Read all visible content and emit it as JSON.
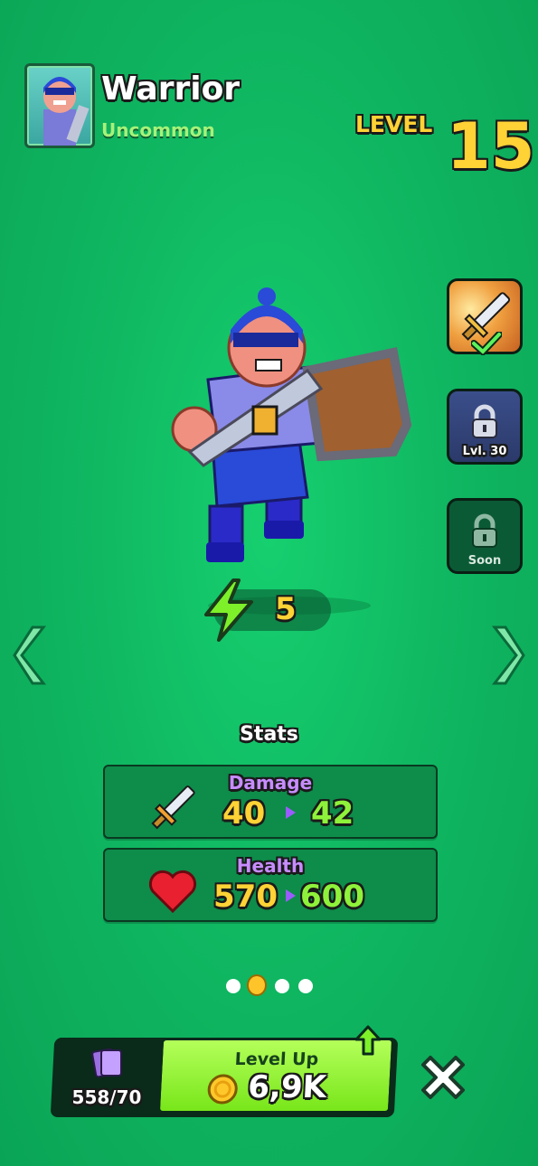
{
  "hero": {
    "name": "Warrior",
    "rarity": "Uncommon",
    "level_label": "LEVEL",
    "level": "15"
  },
  "skills": [
    {
      "name": "sword-skill",
      "state": "equipped"
    },
    {
      "name": "locked-skill",
      "caption": "Lvl. 30"
    },
    {
      "name": "coming-soon-skill",
      "caption": "Soon"
    }
  ],
  "energy": {
    "value": "5"
  },
  "stats": {
    "title": "Stats",
    "damage": {
      "label": "Damage",
      "current": "40",
      "next": "42"
    },
    "health": {
      "label": "Health",
      "current": "570",
      "next": "600"
    }
  },
  "pagination": {
    "count": 4,
    "active_index": 1
  },
  "footer": {
    "cards_count": "558/70",
    "levelup_label": "Level Up",
    "levelup_cost": "6,9K"
  },
  "colors": {
    "accent_yellow": "#ffd235",
    "stat_new_green": "#8ef23a",
    "stat_label_purple": "#c78cff",
    "background": "#10b862"
  }
}
